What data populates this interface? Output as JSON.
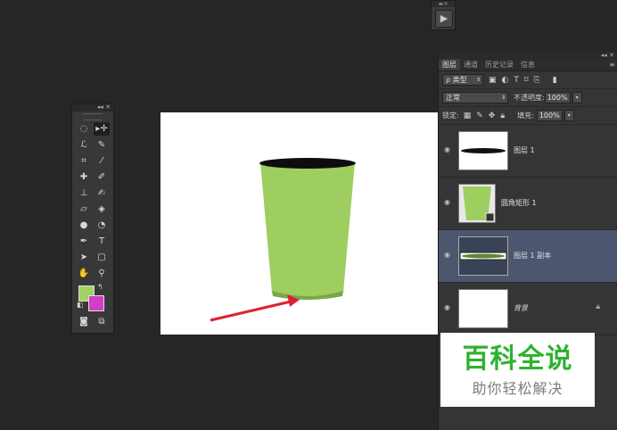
{
  "mini_panel": {
    "header": "▸▸ ✕",
    "play_label": "▶"
  },
  "tools_panel": {
    "header": "◂◂ ✕",
    "tools": [
      {
        "name": "marquee-tool-icon",
        "glyph": "◌"
      },
      {
        "name": "move-tool-icon",
        "glyph": "▸✛"
      },
      {
        "name": "lasso-tool-icon",
        "glyph": "ℒ"
      },
      {
        "name": "quick-select-tool-icon",
        "glyph": "✎"
      },
      {
        "name": "crop-tool-icon",
        "glyph": "⌗"
      },
      {
        "name": "eyedropper-tool-icon",
        "glyph": "⁄"
      },
      {
        "name": "healing-brush-tool-icon",
        "glyph": "✚"
      },
      {
        "name": "brush-tool-icon",
        "glyph": "✐"
      },
      {
        "name": "clone-stamp-tool-icon",
        "glyph": "⊥"
      },
      {
        "name": "history-brush-tool-icon",
        "glyph": "✍"
      },
      {
        "name": "eraser-tool-icon",
        "glyph": "▱"
      },
      {
        "name": "paint-bucket-tool-icon",
        "glyph": "◈"
      },
      {
        "name": "blur-tool-icon",
        "glyph": "●"
      },
      {
        "name": "dodge-tool-icon",
        "glyph": "◔"
      },
      {
        "name": "pen-tool-icon",
        "glyph": "✒"
      },
      {
        "name": "type-tool-icon",
        "glyph": "T"
      },
      {
        "name": "path-select-tool-icon",
        "glyph": "➤"
      },
      {
        "name": "shape-tool-icon",
        "glyph": "▢"
      },
      {
        "name": "hand-tool-icon",
        "glyph": "✋"
      },
      {
        "name": "zoom-tool-icon",
        "glyph": "⚲"
      },
      {
        "name": "quick-mask-icon",
        "glyph": "◙"
      },
      {
        "name": "screen-mode-icon",
        "glyph": "⧉"
      }
    ],
    "foreground_color": "#9fd464",
    "background_color": "#d23fc6"
  },
  "layers_panel": {
    "header": "◂◂ ✕",
    "tabs": [
      "图层",
      "通道",
      "历史记录",
      "信息"
    ],
    "active_tab": 0,
    "filter_kind": "ρ 类型",
    "blend_mode": "正常",
    "opacity_label": "不透明度:",
    "opacity_value": "100%",
    "lock_label": "锁定:",
    "fill_label": "填充:",
    "fill_value": "100%",
    "layers": [
      {
        "name": "图层 1",
        "selected": false,
        "locked": false
      },
      {
        "name": "圆角矩形 1",
        "selected": false,
        "locked": false
      },
      {
        "name": "图层 1 副本",
        "selected": true,
        "locked": false
      },
      {
        "name": "背景",
        "selected": false,
        "locked": true
      }
    ]
  },
  "watermark": {
    "title": "百科全说",
    "subtitle": "助你轻松解决"
  },
  "colors": {
    "cup_green": "#9fce60",
    "arrow_red": "#e02030",
    "selected_layer": "#4c566e"
  }
}
